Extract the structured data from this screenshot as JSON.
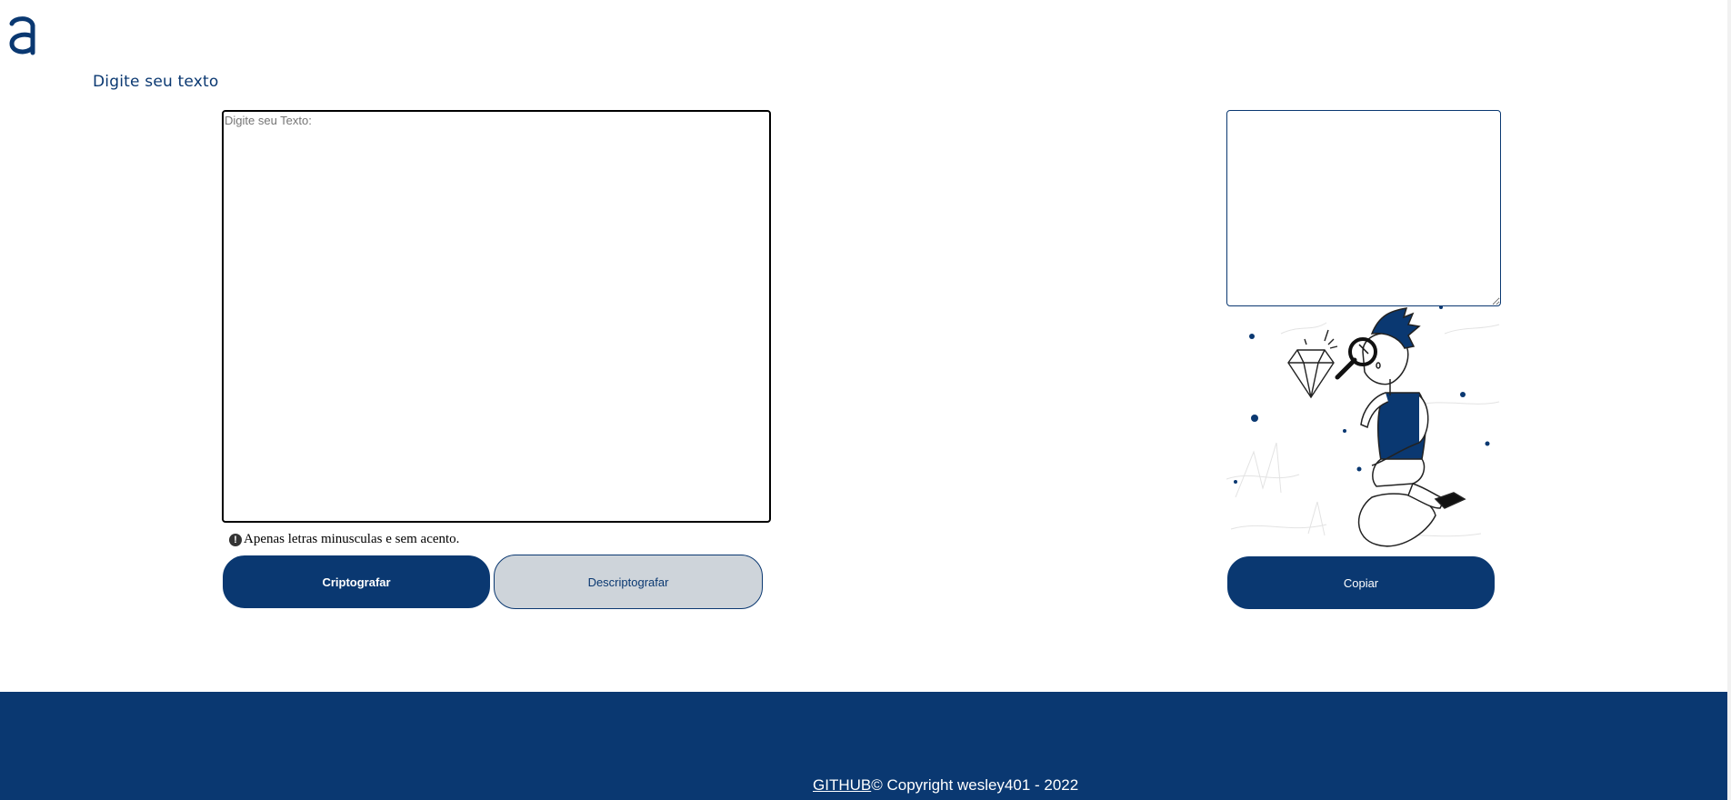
{
  "brand": {
    "logo_icon": "alura-a-logo",
    "accent": "#0a3871",
    "muted": "#ced4da"
  },
  "input_section": {
    "label": "Digite seu texto",
    "textarea_placeholder": "Digite seu Texto:",
    "textarea_value": "",
    "hint_icon": "exclamation-circle-icon",
    "hint_text": "Apenas letras minusculas e sem acento."
  },
  "actions": {
    "encrypt_label": "Criptografar",
    "decrypt_label": "Descriptografar"
  },
  "output_section": {
    "output_value": "",
    "illustration": "person-with-magnifier-illustration",
    "copy_label": "Copiar"
  },
  "footer": {
    "link_label": "GITHUB",
    "copyright": "© Copyright wesley401 - 2022"
  }
}
